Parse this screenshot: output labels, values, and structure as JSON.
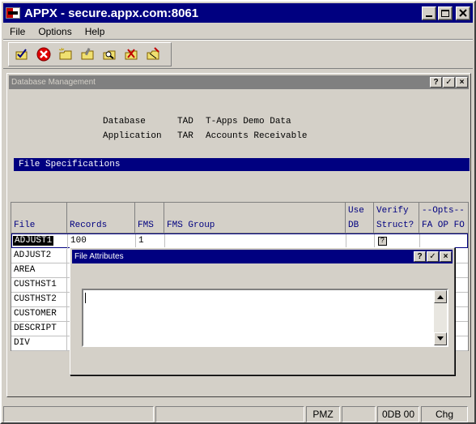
{
  "window": {
    "title": "APPX - secure.appx.com:8061"
  },
  "menu": [
    "File",
    "Options",
    "Help"
  ],
  "toolbar": {
    "icons": [
      "check-folder-icon",
      "cancel-icon",
      "new-folder-icon",
      "edit-folder-icon",
      "search-folder-icon",
      "delete-folder-icon",
      "clear-folder-icon"
    ]
  },
  "dbwin": {
    "title": "Database Management",
    "database_label": "Database",
    "database_code": "TAD",
    "database_name": "T-Apps Demo Data",
    "application_label": "Application",
    "application_code": "TAR",
    "application_name": "Accounts Receivable",
    "section_title": "File Specifications"
  },
  "grid": {
    "headers": {
      "file": "File",
      "records": "Records",
      "fms": "FMS",
      "fms_group": "FMS Group",
      "use_l1": "Use",
      "use_l2": "DB",
      "verify_l1": "Verify",
      "verify_l2": "Struct?",
      "opts_l1": "--Opts--",
      "opts_l2": "FA OP FO"
    },
    "rows": [
      {
        "file": "ADJUST1",
        "records": "100",
        "fms": "1"
      },
      {
        "file": "ADJUST2"
      },
      {
        "file": "AREA"
      },
      {
        "file": "CUSTHST1"
      },
      {
        "file": "CUSTHST2"
      },
      {
        "file": "CUSTOMER"
      },
      {
        "file": "DESCRIPT"
      },
      {
        "file": "DIV"
      }
    ],
    "verify_glyph": "?"
  },
  "file_attributes": {
    "title": "File Attributes"
  },
  "help_glyph": "?",
  "check_glyph": "✓",
  "close_glyph": "×",
  "status": {
    "p3": "PMZ",
    "p5": "0DB 00",
    "p6": "Chg"
  }
}
